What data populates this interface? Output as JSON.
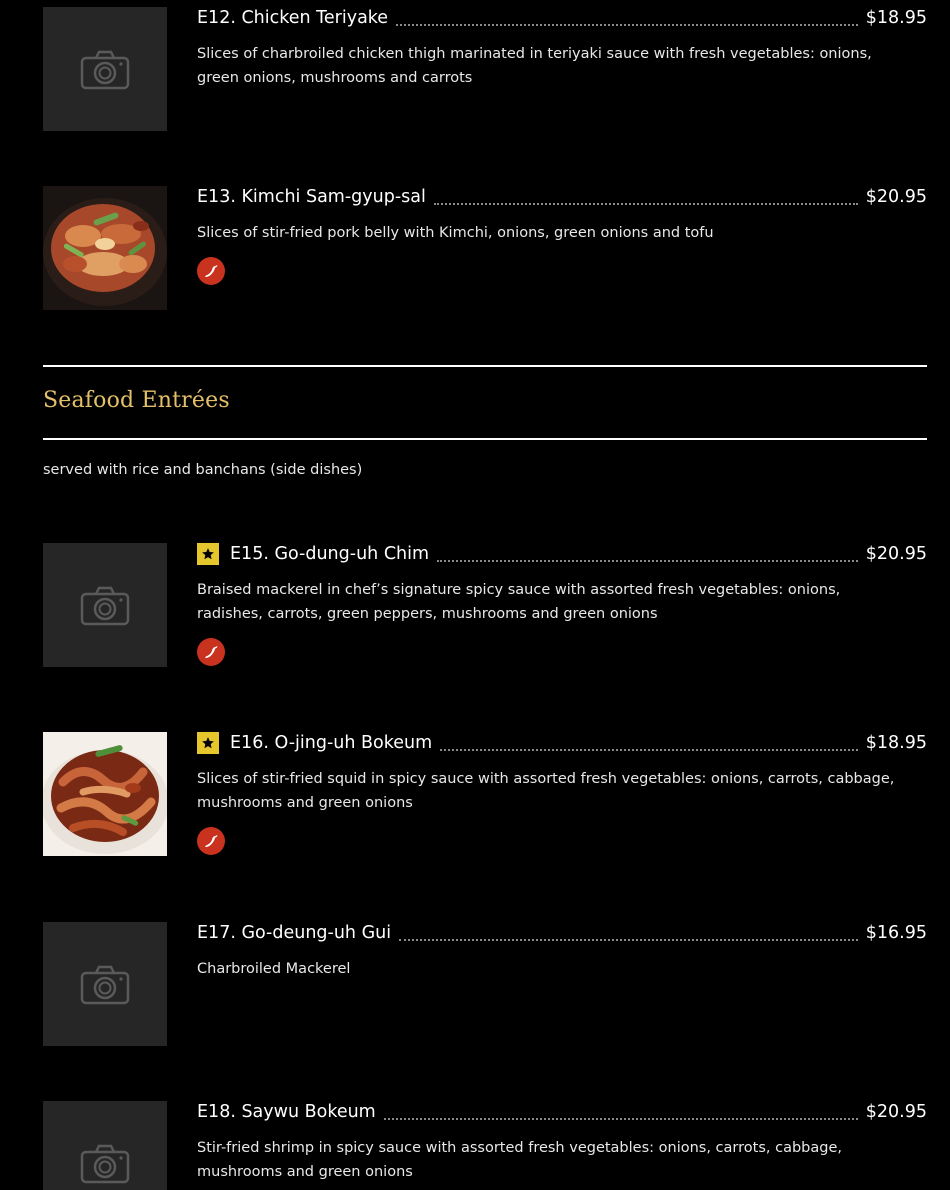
{
  "section": {
    "title": "Seafood Entrées",
    "note": "served with rice and banchans (side dishes)"
  },
  "colors": {
    "background": "#000000",
    "placeholder": "#262626",
    "section_title": "#e4c06a",
    "featured_badge": "#e5c62c",
    "spicy_badge": "#c8321f"
  },
  "items": [
    {
      "name": "E12. Chicken Teriyake",
      "price": "$18.95",
      "description": "Slices of charbroiled chicken thigh marinated in teriyaki sauce with fresh vegetables: onions, green onions, mushrooms and carrots",
      "image": "camera-placeholder-icon",
      "featured": false,
      "spicy": false
    },
    {
      "name": "E13. Kimchi Sam-gyup-sal",
      "price": "$20.95",
      "description": "Slices of stir-fried pork belly with Kimchi, onions, green onions and tofu",
      "image": "food-photo",
      "featured": false,
      "spicy": true
    },
    {
      "name": "E15. Go-dung-uh Chim",
      "price": "$20.95",
      "description": "Braised mackerel in chef’s signature spicy sauce with assorted fresh vegetables: onions, radishes, carrots, green peppers, mushrooms and green onions",
      "image": "camera-placeholder-icon",
      "featured": true,
      "spicy": true
    },
    {
      "name": "E16. O-jing-uh Bokeum",
      "price": "$18.95",
      "description": "Slices of stir-fried squid in spicy sauce with assorted fresh vegetables: onions, carrots, cabbage, mushrooms and green onions",
      "image": "food-photo",
      "featured": true,
      "spicy": true
    },
    {
      "name": "E17. Go-deung-uh Gui",
      "price": "$16.95",
      "description": "Charbroiled Mackerel",
      "image": "camera-placeholder-icon",
      "featured": false,
      "spicy": false
    },
    {
      "name": "E18. Saywu Bokeum",
      "price": "$20.95",
      "description": "Stir-fried shrimp in spicy sauce with assorted fresh vegetables: onions, carrots, cabbage, mushrooms and green onions",
      "image": "camera-placeholder-icon",
      "featured": false,
      "spicy": false
    }
  ]
}
